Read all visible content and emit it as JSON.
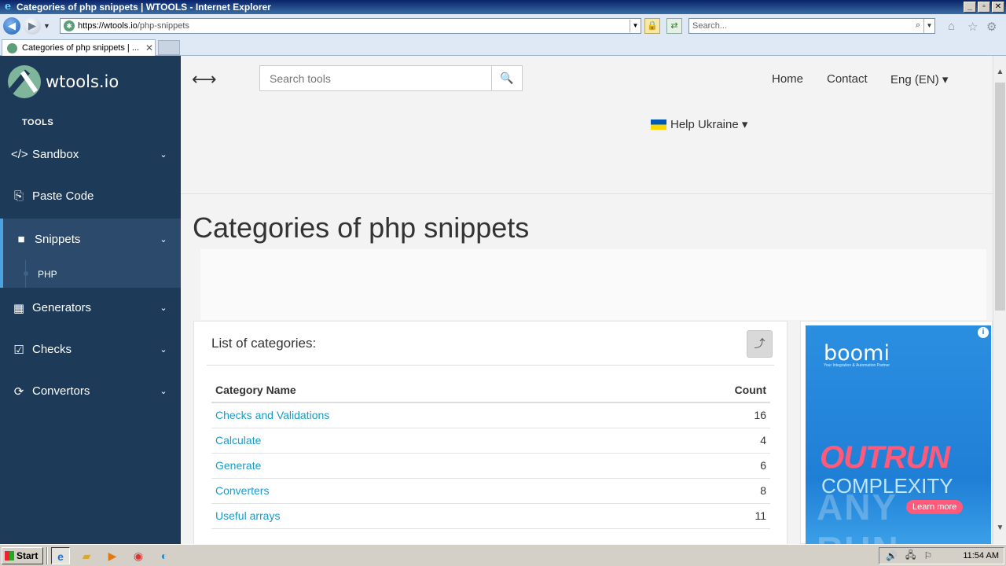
{
  "window": {
    "title": "Categories of php snippets | WTOOLS - Internet Explorer",
    "controls": [
      "_",
      "▫",
      "✕"
    ]
  },
  "browser": {
    "url_host": "https://wtools.io",
    "url_path": "/php-snippets",
    "search_placeholder": "Search...",
    "tab_label": "Categories of php snippets | ...",
    "tab_close": "✕"
  },
  "sidebar": {
    "brand": "wtools.io",
    "section_heading": "TOOLS",
    "items": [
      {
        "label": "Sandbox",
        "icon": "</>"
      },
      {
        "label": "Paste Code",
        "icon": "⎘"
      },
      {
        "label": "Snippets",
        "icon": "■"
      },
      {
        "label": "Generators",
        "icon": "▦"
      },
      {
        "label": "Checks",
        "icon": "☑"
      },
      {
        "label": "Convertors",
        "icon": "⟳"
      }
    ],
    "sub_item": "PHP",
    "chevron": "⌄"
  },
  "header": {
    "toggle_icon": "⟷",
    "search_placeholder": "Search tools",
    "search_icon": "🔍",
    "nav": {
      "home": "Home",
      "contact": "Contact",
      "language": "Eng (EN) ▾"
    },
    "help_ukraine": "Help Ukraine ▾"
  },
  "main": {
    "title": "Categories of php snippets",
    "card_title": "List of categories:",
    "share_icon": "⤴",
    "table": {
      "headers": [
        "Category Name",
        "Count"
      ],
      "rows": [
        {
          "name": "Checks and Validations",
          "count": "16"
        },
        {
          "name": "Calculate",
          "count": "4"
        },
        {
          "name": "Generate",
          "count": "6"
        },
        {
          "name": "Converters",
          "count": "8"
        },
        {
          "name": "Useful arrays",
          "count": "11"
        }
      ]
    }
  },
  "ad": {
    "info": "i",
    "brand": "boomi",
    "tagline": "Your Integration & Automation Partner",
    "headline1": "OUTRUN",
    "headline2": "COMPLEXITY",
    "cta": "Learn more",
    "watermark": "ANY RUN"
  },
  "taskbar": {
    "start": "Start",
    "clock": "11:54 AM"
  }
}
